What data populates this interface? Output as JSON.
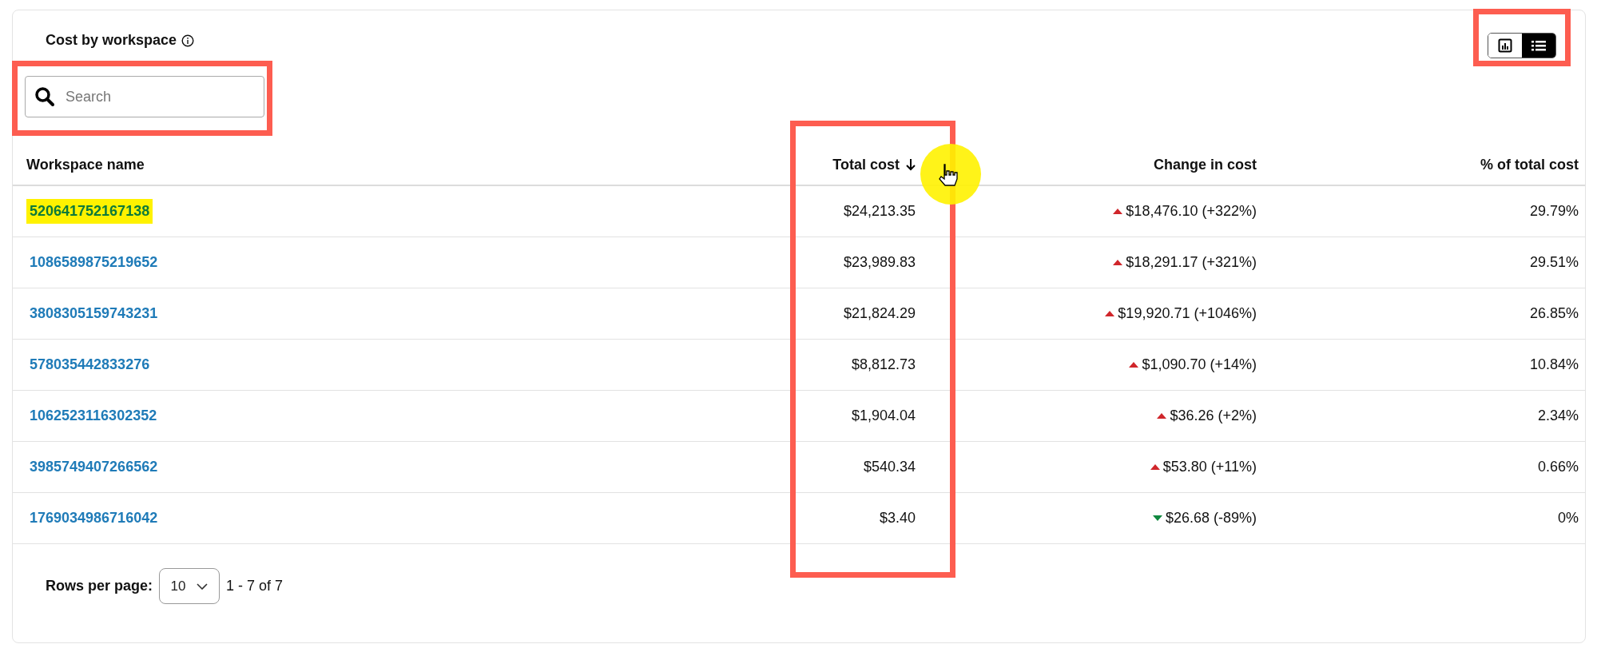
{
  "title": "Cost by workspace",
  "view_toggle": [
    {
      "kind": "chart",
      "selected": false
    },
    {
      "kind": "list",
      "selected": true
    }
  ],
  "search": {
    "placeholder": "Search"
  },
  "table": {
    "columns": [
      {
        "label": "Workspace name",
        "sorted": false
      },
      {
        "label": "Total cost",
        "sorted": true
      },
      {
        "label": "Change in cost",
        "sorted": false
      },
      {
        "label": "% of total cost",
        "sorted": false
      }
    ],
    "rows": [
      {
        "name": "520641752167138",
        "total": "$24,213.35",
        "kind": "up",
        "change": "$18,476.10 (+322%)",
        "share": "29.79%",
        "highlighted": true
      },
      {
        "name": "1086589875219652",
        "total": "$23,989.83",
        "kind": "up",
        "change": "$18,291.17 (+321%)",
        "share": "29.51%",
        "highlighted": false
      },
      {
        "name": "3808305159743231",
        "total": "$21,824.29",
        "kind": "up",
        "change": "$19,920.71 (+1046%)",
        "share": "26.85%",
        "highlighted": false
      },
      {
        "name": "578035442833276",
        "total": "$8,812.73",
        "kind": "up",
        "change": "$1,090.70 (+14%)",
        "share": "10.84%",
        "highlighted": false
      },
      {
        "name": "1062523116302352",
        "total": "$1,904.04",
        "kind": "up",
        "change": "$36.26 (+2%)",
        "share": "2.34%",
        "highlighted": false
      },
      {
        "name": "3985749407266562",
        "total": "$540.34",
        "kind": "up",
        "change": "$53.80 (+11%)",
        "share": "0.66%",
        "highlighted": false
      },
      {
        "name": "1769034986716042",
        "total": "$3.40",
        "kind": "down",
        "change": "$26.68 (-89%)",
        "share": "0%",
        "highlighted": false
      }
    ]
  },
  "pagination": {
    "label": "Rows per page:",
    "page_size": "10",
    "range": "1 - 7 of 7"
  }
}
